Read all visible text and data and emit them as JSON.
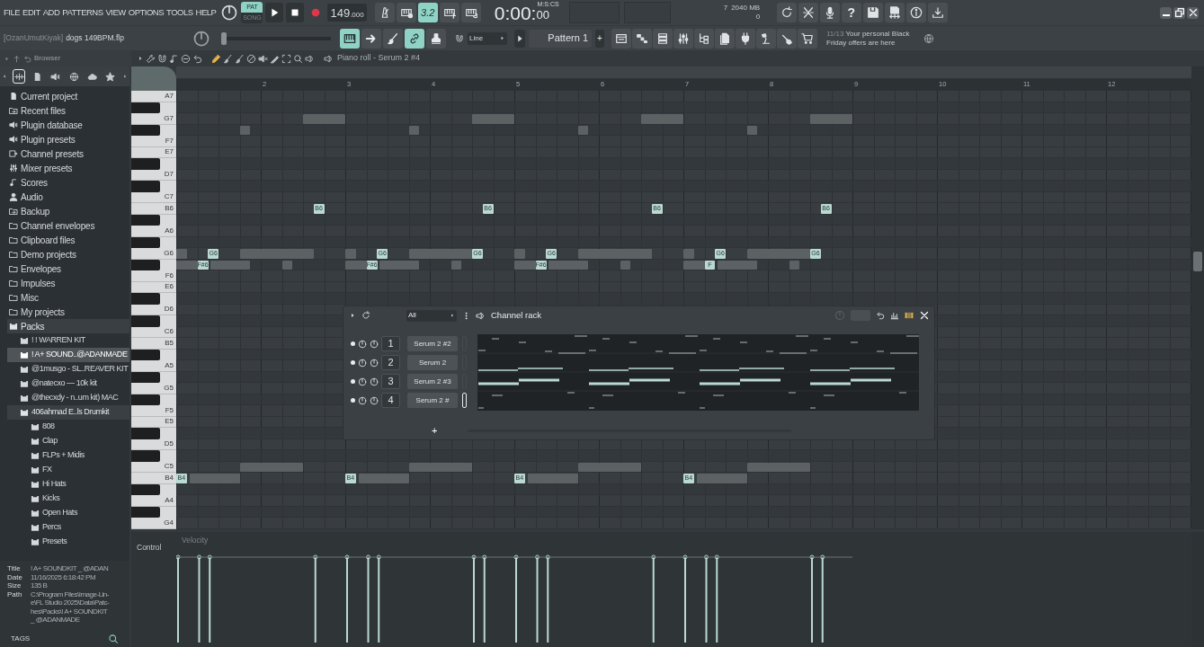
{
  "menu": [
    "FILE",
    "EDIT",
    "ADD",
    "PATTERNS",
    "VIEW",
    "OPTIONS",
    "TOOLS",
    "HELP"
  ],
  "transport": {
    "modes": [
      {
        "label": "PAT",
        "selected": true
      },
      {
        "label": "SONG",
        "selected": false
      }
    ],
    "tempo": "149",
    "tempo_fraction": ".000"
  },
  "record_toggles": [
    {
      "kind": "metronome",
      "on": false
    },
    {
      "kind": "keyboard-clock",
      "on": false
    },
    {
      "kind": "countdown",
      "label": "3.2",
      "on": true
    },
    {
      "kind": "keyboard-plus",
      "on": false
    },
    {
      "kind": "keyboard-loop",
      "on": false
    }
  ],
  "time": {
    "value": "0:00:",
    "centiseconds": "00",
    "unit": "M:S:CS"
  },
  "monitor": {
    "polyphony": "7",
    "memory": "2040 MB",
    "cpu": "0"
  },
  "help": "?",
  "project": {
    "user": "[OzanUmutKiyak]",
    "file": "dogs 149BPM.flp"
  },
  "master_pitch": {
    "level": 0
  },
  "tools": [
    {
      "kind": "keyboard",
      "on": true
    },
    {
      "kind": "arrow-right",
      "on": false
    },
    {
      "kind": "brush",
      "on": false
    },
    {
      "kind": "link",
      "on": true
    },
    {
      "kind": "stamp",
      "on": false
    }
  ],
  "snap": "Line",
  "pattern": "Pattern 1",
  "pattern_add": "+",
  "news": {
    "counter": "11/13",
    "text": "Your personal Black Friday offers are here"
  },
  "browser": {
    "title": "Browser",
    "tabs": [
      {
        "kind": "waveform",
        "selected": true
      },
      {
        "kind": "file",
        "selected": false
      },
      {
        "kind": "speaker",
        "selected": false
      },
      {
        "kind": "globe",
        "selected": false
      },
      {
        "kind": "cloud",
        "selected": false
      },
      {
        "kind": "star",
        "selected": false
      }
    ],
    "items": [
      {
        "label": "Current project",
        "kind": "file",
        "selected": false
      },
      {
        "label": "Recent files",
        "kind": "folder-arrow",
        "selected": false
      },
      {
        "label": "Plugin database",
        "kind": "speaker",
        "selected": false
      },
      {
        "label": "Plugin presets",
        "kind": "speaker",
        "selected": false
      },
      {
        "label": "Channel presets",
        "kind": "channel",
        "selected": false
      },
      {
        "label": "Mixer presets",
        "kind": "sliders",
        "selected": false
      },
      {
        "label": "Scores",
        "kind": "note",
        "selected": false
      },
      {
        "label": "Audio",
        "kind": "person",
        "selected": false
      },
      {
        "label": "Backup",
        "kind": "folder-arrow",
        "selected": false
      },
      {
        "label": "Channel envelopes",
        "kind": "folder",
        "selected": false
      },
      {
        "label": "Clipboard files",
        "kind": "folder",
        "selected": false
      },
      {
        "label": "Demo projects",
        "kind": "folder",
        "selected": false
      },
      {
        "label": "Envelopes",
        "kind": "folder",
        "selected": false
      },
      {
        "label": "Impulses",
        "kind": "folder",
        "selected": false
      },
      {
        "label": "Misc",
        "kind": "folder",
        "selected": false
      },
      {
        "label": "My projects",
        "kind": "folder",
        "selected": false
      },
      {
        "label": "Packs",
        "kind": "crate",
        "selected": false,
        "expanded": true,
        "children": [
          {
            "label": "! ! WARREN KIT",
            "kind": "crate",
            "selected": false
          },
          {
            "label": "! A+ SOUND..@ADANMADE",
            "kind": "crate",
            "selected": true
          },
          {
            "label": "@1musgo - SL..REAVER KIT",
            "kind": "crate",
            "selected": false
          },
          {
            "label": "@natecxo — 10k kit",
            "kind": "crate",
            "selected": false
          },
          {
            "label": "@thecxdy - n..um kit) MAC",
            "kind": "crate",
            "selected": false
          },
          {
            "label": "406ahmad E..ls Drumkit",
            "kind": "crate",
            "selected": false,
            "expanded": true,
            "children": [
              {
                "label": "808",
                "kind": "crate",
                "selected": false
              },
              {
                "label": "Clap",
                "kind": "crate",
                "selected": false
              },
              {
                "label": "FLPs + Midis",
                "kind": "crate",
                "selected": false
              },
              {
                "label": "FX",
                "kind": "crate",
                "selected": false
              },
              {
                "label": "Hi Hats",
                "kind": "crate",
                "selected": false
              },
              {
                "label": "Kicks",
                "kind": "crate",
                "selected": false
              },
              {
                "label": "Open Hats",
                "kind": "crate",
                "selected": false
              },
              {
                "label": "Percs",
                "kind": "crate",
                "selected": false
              },
              {
                "label": "Presets",
                "kind": "crate",
                "selected": false
              }
            ]
          }
        ]
      }
    ],
    "info": [
      {
        "key": "Title",
        "lines": [
          "! A+ SOUNDKIT _ @ADAN"
        ]
      },
      {
        "key": "Date",
        "lines": [
          "11/16/2025 6:18:42 PM"
        ]
      },
      {
        "key": "Size",
        "lines": [
          "135 B"
        ]
      },
      {
        "key": "Path",
        "lines": [
          "C:\\Program Files\\Image-Lin-",
          "e\\FL Studio 2025\\Data\\Patc-",
          "hes\\Packs\\! A+ SOUNDKIT",
          "_ @ADANMADE"
        ]
      }
    ],
    "tags": "TAGS"
  },
  "piano_roll": {
    "title": "Piano roll - Serum 2 #4",
    "bars": [
      "2",
      "3",
      "4",
      "5",
      "6",
      "7",
      "8",
      "9",
      "10",
      "11",
      "12"
    ],
    "keys": [
      {
        "kind": "white",
        "label": "A7"
      },
      {
        "kind": "black"
      },
      {
        "kind": "white",
        "label": "G7"
      },
      {
        "kind": "black"
      },
      {
        "kind": "white",
        "label": "F7"
      },
      {
        "kind": "white",
        "label": "E7"
      },
      {
        "kind": "black"
      },
      {
        "kind": "white",
        "label": "D7"
      },
      {
        "kind": "black"
      },
      {
        "kind": "white",
        "label": "C7"
      },
      {
        "kind": "white",
        "label": "B6",
        "notes": [
          {
            "label": "B6"
          },
          {
            "label": "B6"
          },
          {
            "label": "B6"
          },
          {
            "label": "B6"
          }
        ]
      },
      {
        "kind": "black"
      },
      {
        "kind": "white",
        "label": "A6"
      },
      {
        "kind": "black"
      },
      {
        "kind": "white",
        "label": "G6",
        "notes": [
          {
            "label": "G6"
          },
          {
            "label": "G6"
          },
          {
            "label": "G6"
          },
          {
            "label": "G6"
          },
          {
            "label": "G6"
          },
          {
            "label": "G6"
          }
        ]
      },
      {
        "kind": "black",
        "notes": [
          {
            "label": "F#6"
          },
          {
            "label": "F#6"
          },
          {
            "label": "F#6"
          },
          {
            "label": "F"
          }
        ]
      },
      {
        "kind": "white",
        "label": "F6"
      },
      {
        "kind": "white",
        "label": "E6"
      },
      {
        "kind": "black"
      },
      {
        "kind": "white",
        "label": "D6"
      },
      {
        "kind": "black"
      },
      {
        "kind": "white",
        "label": "C6"
      },
      {
        "kind": "white",
        "label": "B5"
      },
      {
        "kind": "black"
      },
      {
        "kind": "white",
        "label": "A5"
      },
      {
        "kind": "black"
      },
      {
        "kind": "white",
        "label": "G5"
      },
      {
        "kind": "black"
      },
      {
        "kind": "white",
        "label": "F5"
      },
      {
        "kind": "white",
        "label": "E5"
      },
      {
        "kind": "black"
      },
      {
        "kind": "white",
        "label": "D5"
      },
      {
        "kind": "black"
      },
      {
        "kind": "white",
        "label": "C5"
      },
      {
        "kind": "white",
        "label": "B4",
        "notes": [
          {
            "label": "B4"
          },
          {
            "label": "B4"
          },
          {
            "label": "B4"
          },
          {
            "label": "B4"
          }
        ]
      },
      {
        "kind": "black"
      },
      {
        "kind": "white",
        "label": "A4"
      },
      {
        "kind": "black"
      },
      {
        "kind": "white",
        "label": "G4"
      }
    ]
  },
  "control": {
    "label": "Control",
    "parameter": "Velocity"
  },
  "channel_rack": {
    "title": "Channel rack",
    "filter": "All",
    "add": "+",
    "channels": [
      {
        "number": "1",
        "name": "Serum 2 #2",
        "selected": false
      },
      {
        "number": "2",
        "name": "Serum 2",
        "selected": false
      },
      {
        "number": "3",
        "name": "Serum 2 #3",
        "selected": false
      },
      {
        "number": "4",
        "name": "Serum 2 #",
        "selected": true
      }
    ]
  }
}
